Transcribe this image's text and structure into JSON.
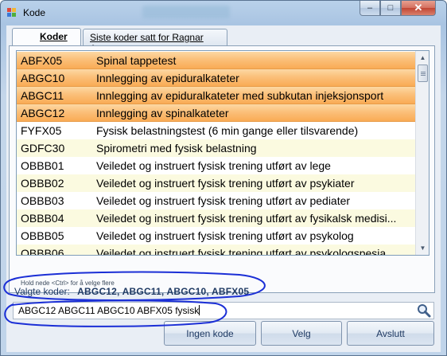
{
  "window": {
    "title": "Kode",
    "controls": {
      "minimize": "–",
      "maximize": "□",
      "close": "✕"
    }
  },
  "tabs": [
    {
      "label": "Koder",
      "active": true
    },
    {
      "label": "Siste koder satt for Ragnar Aga",
      "active": false
    }
  ],
  "list": {
    "rows": [
      {
        "code": "ABFX05",
        "desc": "Spinal tappetest",
        "state": "selected"
      },
      {
        "code": "ABGC10",
        "desc": "Innlegging av epiduralkateter",
        "state": "selected"
      },
      {
        "code": "ABGC11",
        "desc": "Innlegging av epiduralkateter med subkutan injeksjonsport",
        "state": "selected"
      },
      {
        "code": "ABGC12",
        "desc": "Innlegging av spinalkateter",
        "state": "selected"
      },
      {
        "code": "FYFX05",
        "desc": "Fysisk belastningstest (6 min gange eller tilsvarende)",
        "state": "white"
      },
      {
        "code": "GDFC30",
        "desc": "Spirometri med fysisk belastning",
        "state": "cream"
      },
      {
        "code": "OBBB01",
        "desc": "Veiledet og instruert fysisk trening utført av lege",
        "state": "white"
      },
      {
        "code": "OBBB02",
        "desc": "Veiledet og instruert fysisk trening utført av psykiater",
        "state": "cream"
      },
      {
        "code": "OBBB03",
        "desc": "Veiledet og instruert fysisk trening utført av pediater",
        "state": "white"
      },
      {
        "code": "OBBB04",
        "desc": "Veiledet og instruert fysisk trening utført av fysikalsk medisi...",
        "state": "cream"
      },
      {
        "code": "OBBB05",
        "desc": "Veiledet og instruert fysisk trening utført av psykolog",
        "state": "white"
      },
      {
        "code": "OBBB06",
        "desc": "Veiledet og instruert fysisk trening utført av psykologspesia...",
        "state": "cream"
      }
    ],
    "hint": "Hold nede <Ctrl> for å velge flere"
  },
  "selected": {
    "label": "Valgte koder:",
    "value": "ABGC12, ABGC11, ABGC10, ABFX05"
  },
  "search": {
    "value": "ABGC12  ABGC11  ABGC10  ABFX05 fysisk"
  },
  "buttons": {
    "ingen": "Ingen kode",
    "velg": "Velg",
    "avslutt": "Avslutt"
  },
  "colors": {
    "selected_row": "#f9ab55",
    "alt_row": "#fbfae0",
    "annotation": "#1b2fd6",
    "label_text": "#1f3a63"
  }
}
